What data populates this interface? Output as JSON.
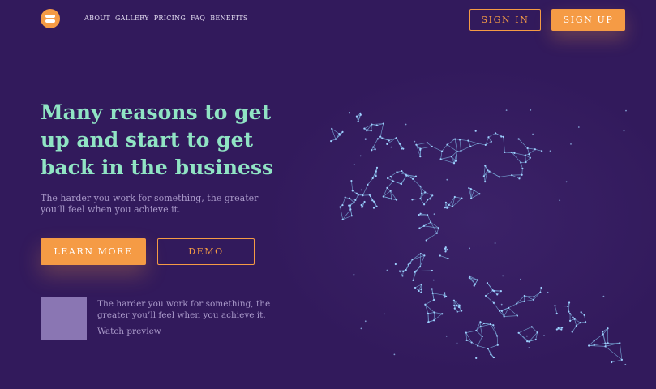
{
  "header": {
    "logo_icon": "logo-icon",
    "nav": [
      "ABOUT",
      "GALLERY",
      "PRICING",
      "FAQ",
      "BENEFITS"
    ],
    "sign_in": "SIGN IN",
    "sign_up": "SIGN UP"
  },
  "hero": {
    "title": "Many reasons to get up and start to get back in the business",
    "subtitle": "The harder you work for something, the greater you’ll feel when you achieve it.",
    "learn_more": "LEARN MORE",
    "demo": "DEMO",
    "image": "running-man-polygon-illustration"
  },
  "preview": {
    "caption": "The harder you work for something, the greater you’ll feel when you achieve it.",
    "link": "Watch preview",
    "thumb_icon": "video-thumbnail"
  },
  "colors": {
    "background": "#321a5c",
    "accent": "#f59b45",
    "title": "#90e4c4",
    "text": "#a999c9",
    "thumbnail": "#8a76b3",
    "mesh": "#7fb8e4"
  }
}
